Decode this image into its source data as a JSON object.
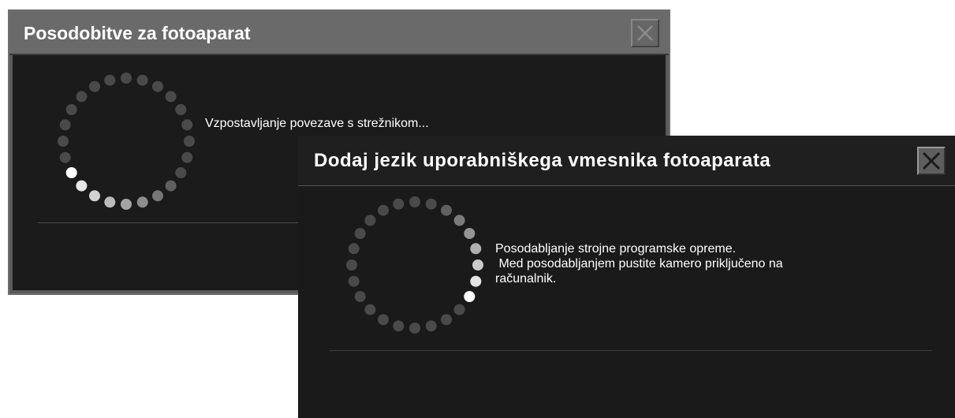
{
  "window_back": {
    "title": "Posodobitve za fotoaparat",
    "message": "Vzpostavljanje povezave s strežnikom...",
    "close_icon": "close-x-icon",
    "spinner_icon": "loading-spinner-icon"
  },
  "window_front": {
    "title": "Dodaj jezik uporabniškega vmesnika fotoaparata",
    "message_lines": [
      "Posodabljanje strojne programske opreme.",
      " Med posodabljanjem pustite kamero priključeno na",
      "računalnik."
    ],
    "close_icon": "close-x-icon",
    "spinner_icon": "loading-spinner-icon"
  },
  "colors": {
    "window_bg": "#1a1a1a",
    "title_bar_back": "#6a6a6a",
    "dot_dim": "#4d4d4d",
    "dot_bright": "#ffffff"
  }
}
